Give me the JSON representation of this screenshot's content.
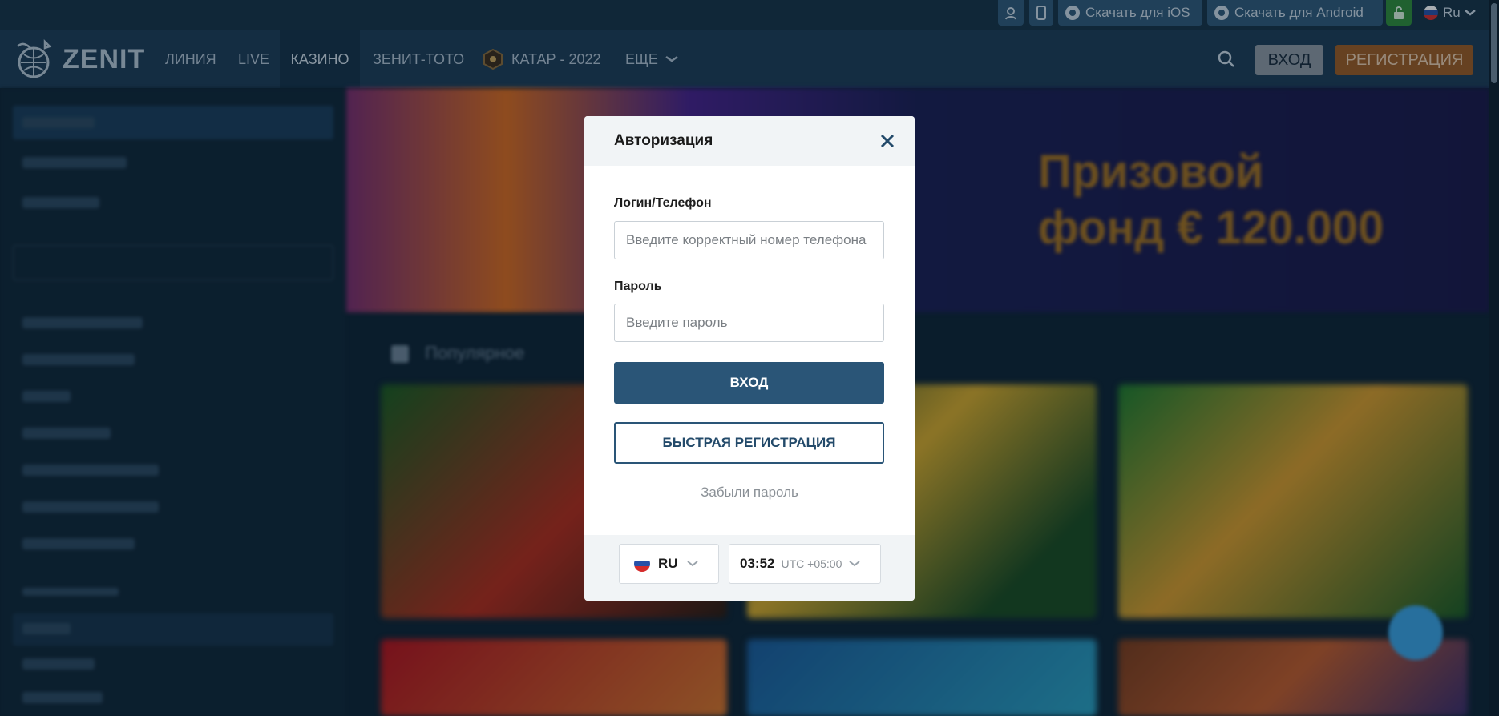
{
  "topbar": {
    "download_ios": "Скачать для iOS",
    "download_android": "Скачать для Android",
    "language": "Ru"
  },
  "header": {
    "logo_text": "ZENIT",
    "nav": [
      "ЛИНИЯ",
      "LIVE",
      "КАЗИНО",
      "ЗЕНИТ-ТОТО",
      "КАТАР - 2022",
      "ЕЩЕ"
    ],
    "active_nav": "КАЗИНО",
    "login_label": "ВХОД",
    "register_label": "РЕГИСТРАЦИЯ"
  },
  "background": {
    "banner_text_line1": "Призовой",
    "banner_text_line2": "фонд € 120.000",
    "section_title": "Популярное"
  },
  "modal": {
    "title": "Авторизация",
    "login_label": "Логин/Телефон",
    "login_placeholder": "Введите корректный номер телефона",
    "password_label": "Пароль",
    "password_placeholder": "Введите пароль",
    "submit_label": "ВХОД",
    "quick_register_label": "БЫСТРАЯ РЕГИСТРАЦИЯ",
    "forgot_label": "Забыли пароль",
    "footer": {
      "language": "RU",
      "time": "03:52",
      "timezone": "UTC +05:00"
    }
  },
  "colors": {
    "header_bg": "#1c3b55",
    "primary": "#2a5577",
    "register": "#9a5a22",
    "android_lock": "#2e8a3a"
  }
}
